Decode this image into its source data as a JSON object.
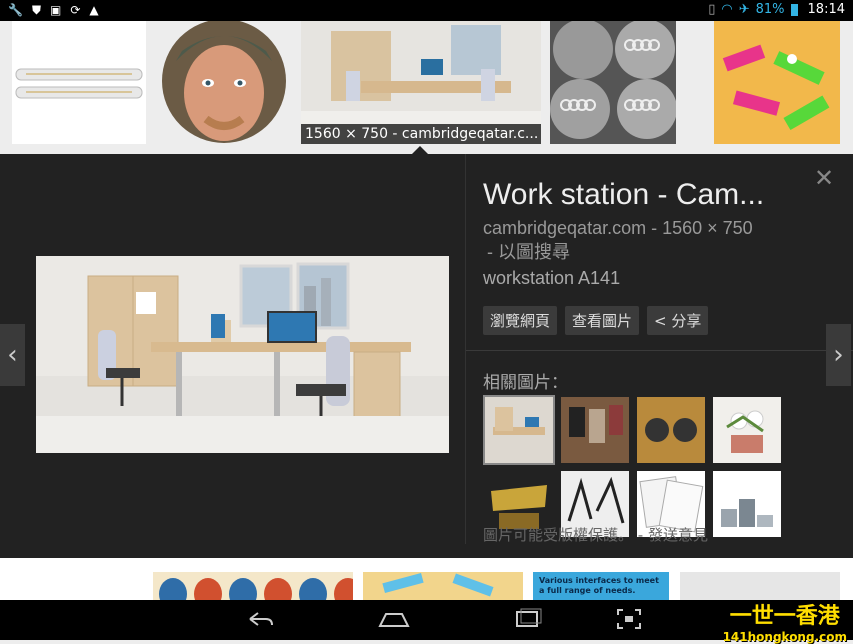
{
  "status_bar": {
    "left_icons": [
      "wrench-icon",
      "shield-icon",
      "image-icon",
      "sync-icon",
      "warning-icon"
    ],
    "right_icons": [
      "vibrate-icon",
      "wifi-icon",
      "airplane-icon",
      "battery-icon"
    ],
    "battery_percent": "81%",
    "time": "18:14"
  },
  "image_strip": {
    "selected_caption": "1560 × 750 - cambridgeqatar.c..."
  },
  "detail": {
    "title": "Work station - Cam...",
    "source_line": "cambridgeqatar.com - 1560 × 750",
    "search_by_image": "- 以圖搜尋",
    "description": "workstation A141",
    "buttons": {
      "visit": "瀏覽網頁",
      "view": "查看圖片",
      "share": "< 分享"
    },
    "related_label": "相關圖片：",
    "copyright_note": "圖片可能受版權保護。 - 發送意見",
    "close_icon": "close-icon",
    "prev_icon": "chevron-left-icon",
    "next_icon": "chevron-right-icon"
  },
  "bottom_strip": {
    "thumb_text": "Various interfaces to meet a full range of needs."
  },
  "navbar": {
    "icons": [
      "back-icon",
      "home-icon",
      "recents-icon",
      "screenshot-icon"
    ]
  },
  "watermark": {
    "line1": "一世一香港",
    "line2": "141hongkong.com"
  },
  "colors": {
    "status_accent": "#33b5e5",
    "panel_bg": "#222222",
    "strip_bg": "#ededed"
  }
}
